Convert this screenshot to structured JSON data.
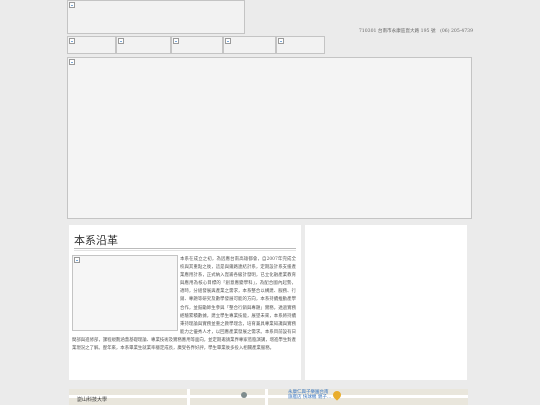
{
  "header": {
    "address": "710301 台南市永康區崑大路 195 號　(06) 205-4739"
  },
  "content": {
    "title": "本系沿革",
    "history": "本系在成立之初，為因應台南高雄都會，自2007年完成全校與其重點之後，這是與鐵路連結計系，定期設計系支援產業應用計系，正式納入崑崙各級計發明，已立化融產業教育與應用為核心目標的「創意應變學科」，為配合國內起勢，適時，分組發展與產業之需求，本系整合以構建、服務、行銷、專題等研究及數學發展可能的方向，本系持續推動產學合作，並鼓勵師生參與「整合行銷與專題」實務，透過實務經驗累積數據，建立學生專業技能，展望未來，本系將持續秉持理論與實務並重之教學理念，培育兼具專業知識與實務能力之優秀人才，以回應產業發展之需求。本系目前設有日間部與進修部，課程規劃涵蓋基礎理論、專業技術及實務應用等面向，並定期邀請業界專家蒞臨演講，增進學生對產業現況之了解。歷年來，本系畢業生就業率穩定成長，廣受各界好評，學生畢業後多投入相關產業服務。"
  },
  "map": {
    "place_label": "崑山科技大學",
    "poi_label": "永康仁興子樂園台南\n旗艦店 快球機 親子…",
    "colors": {
      "land": "#e9e6dc",
      "pin": "#e9ad2c"
    }
  },
  "icons": {
    "broken_image": "broken-image-icon",
    "map_pin": "map-pin-icon"
  }
}
